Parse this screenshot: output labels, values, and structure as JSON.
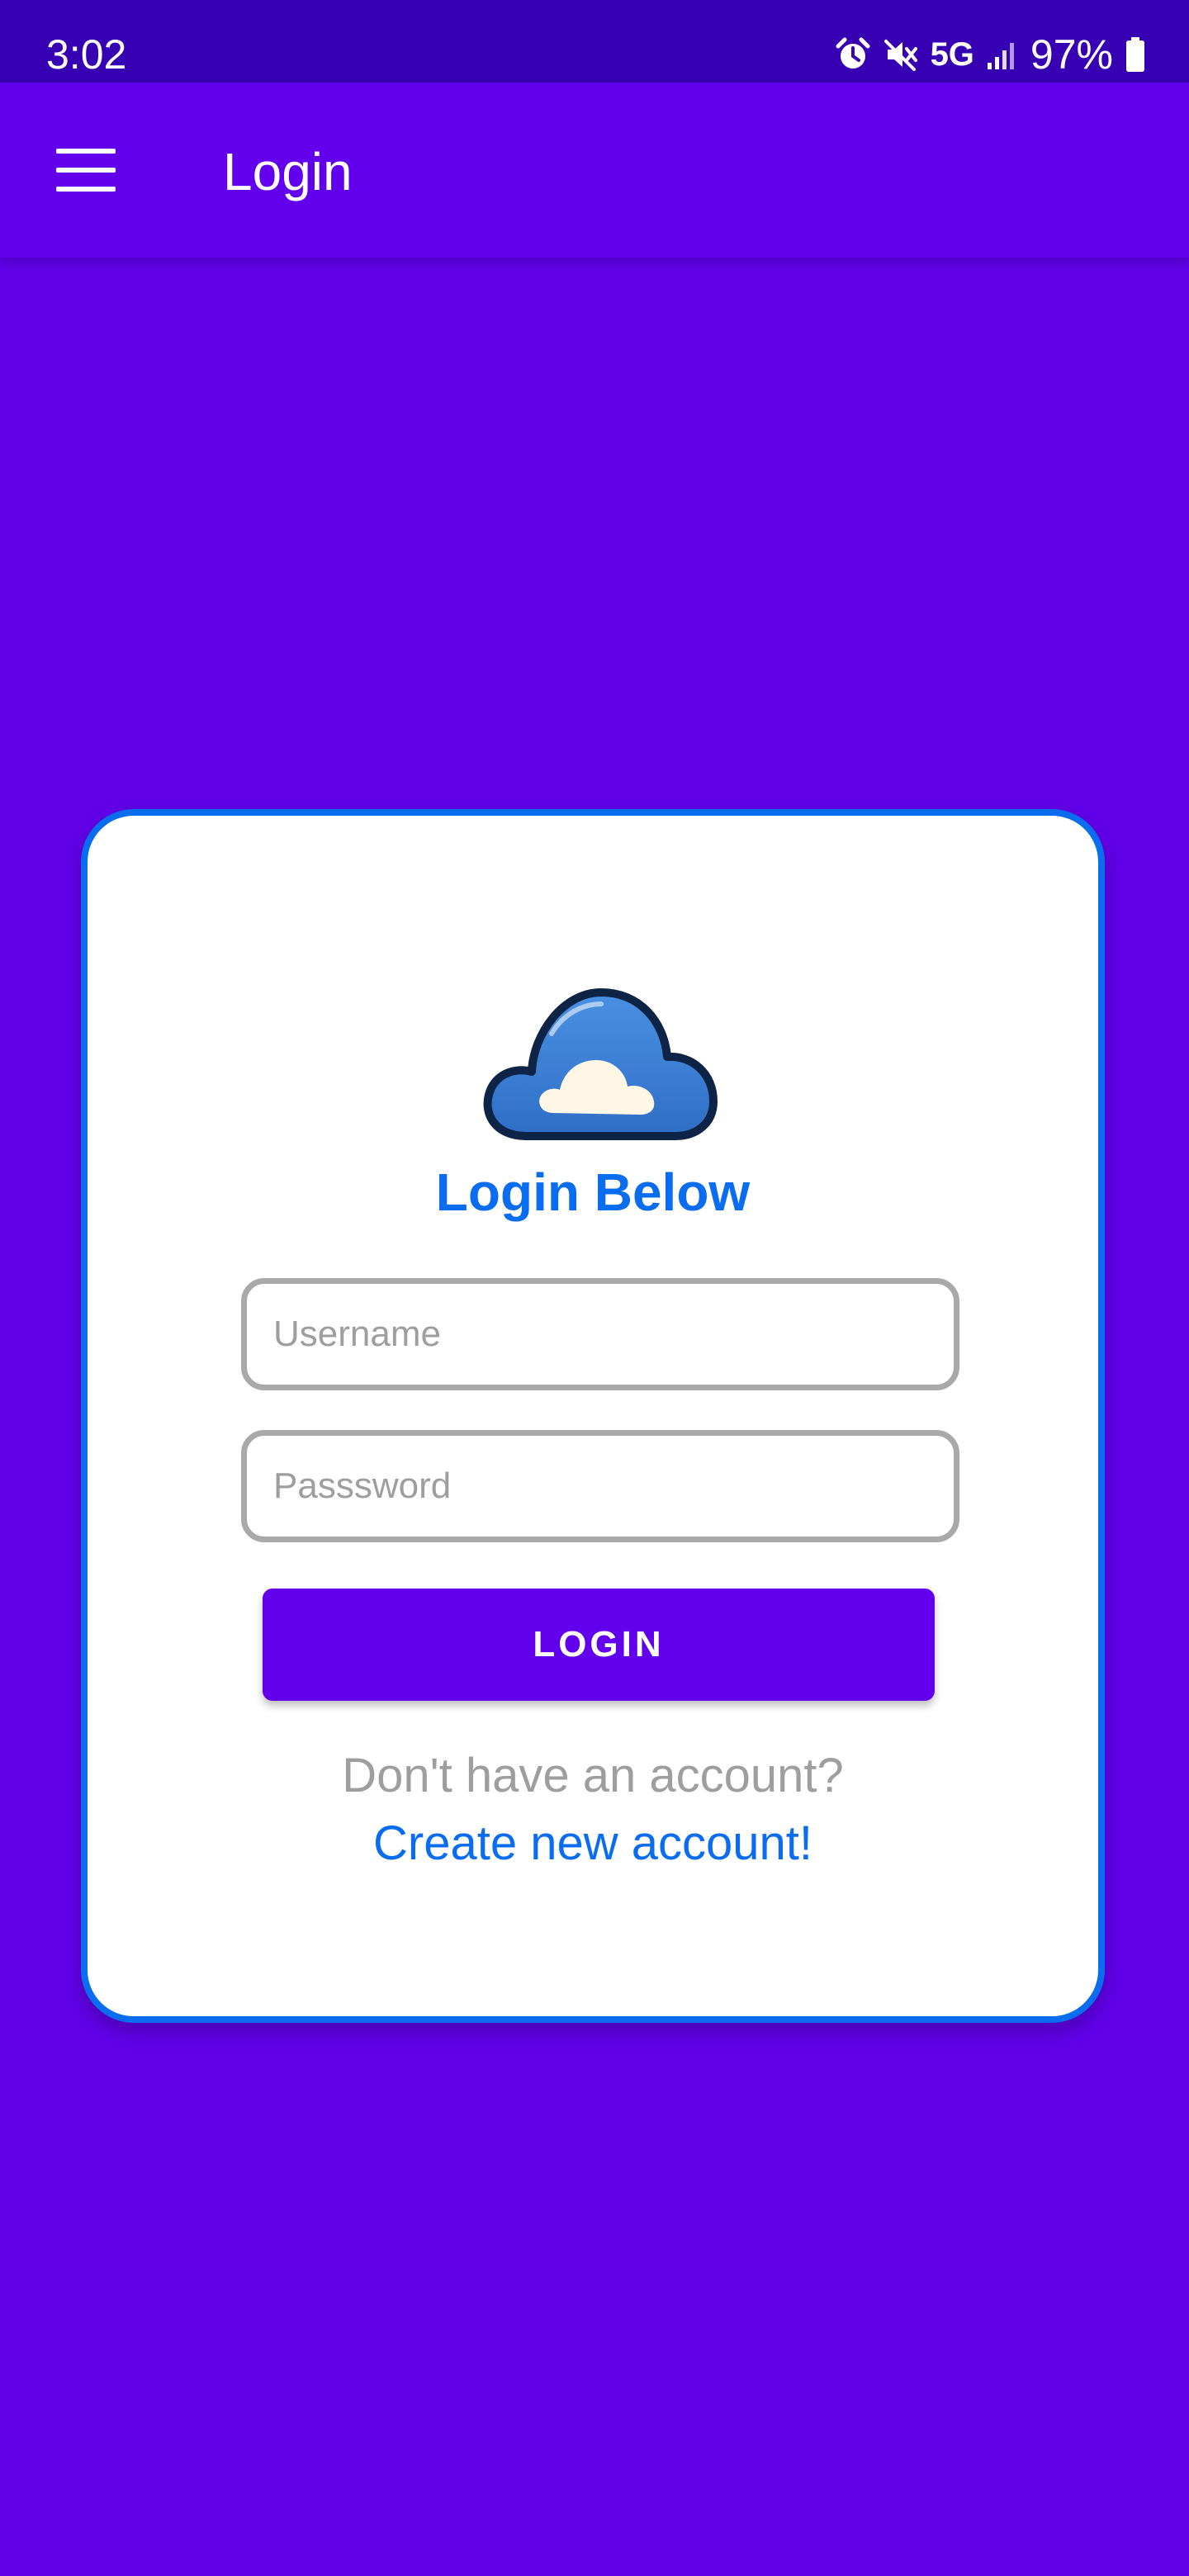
{
  "status_bar": {
    "time": "3:02",
    "network": "5G",
    "battery_percent": "97%",
    "icons": [
      "alarm-icon",
      "mute-icon",
      "signal-icon",
      "battery-icon"
    ]
  },
  "app_bar": {
    "title": "Login",
    "menu_icon": "hamburger-menu-icon"
  },
  "login_card": {
    "logo_icon": "cloud-logo",
    "heading": "Login Below",
    "username": {
      "value": "",
      "placeholder": "Username"
    },
    "password": {
      "value": "",
      "placeholder": "Passsword"
    },
    "login_button_label": "LOGIN",
    "signup_prompt": "Don't have an account?",
    "signup_link": "Create new account!"
  },
  "colors": {
    "background": "#6200EA",
    "status_bar": "#3700B3",
    "accent_blue": "#0A6DF0",
    "button": "#6200EE",
    "muted_text": "#9E9E9E"
  }
}
